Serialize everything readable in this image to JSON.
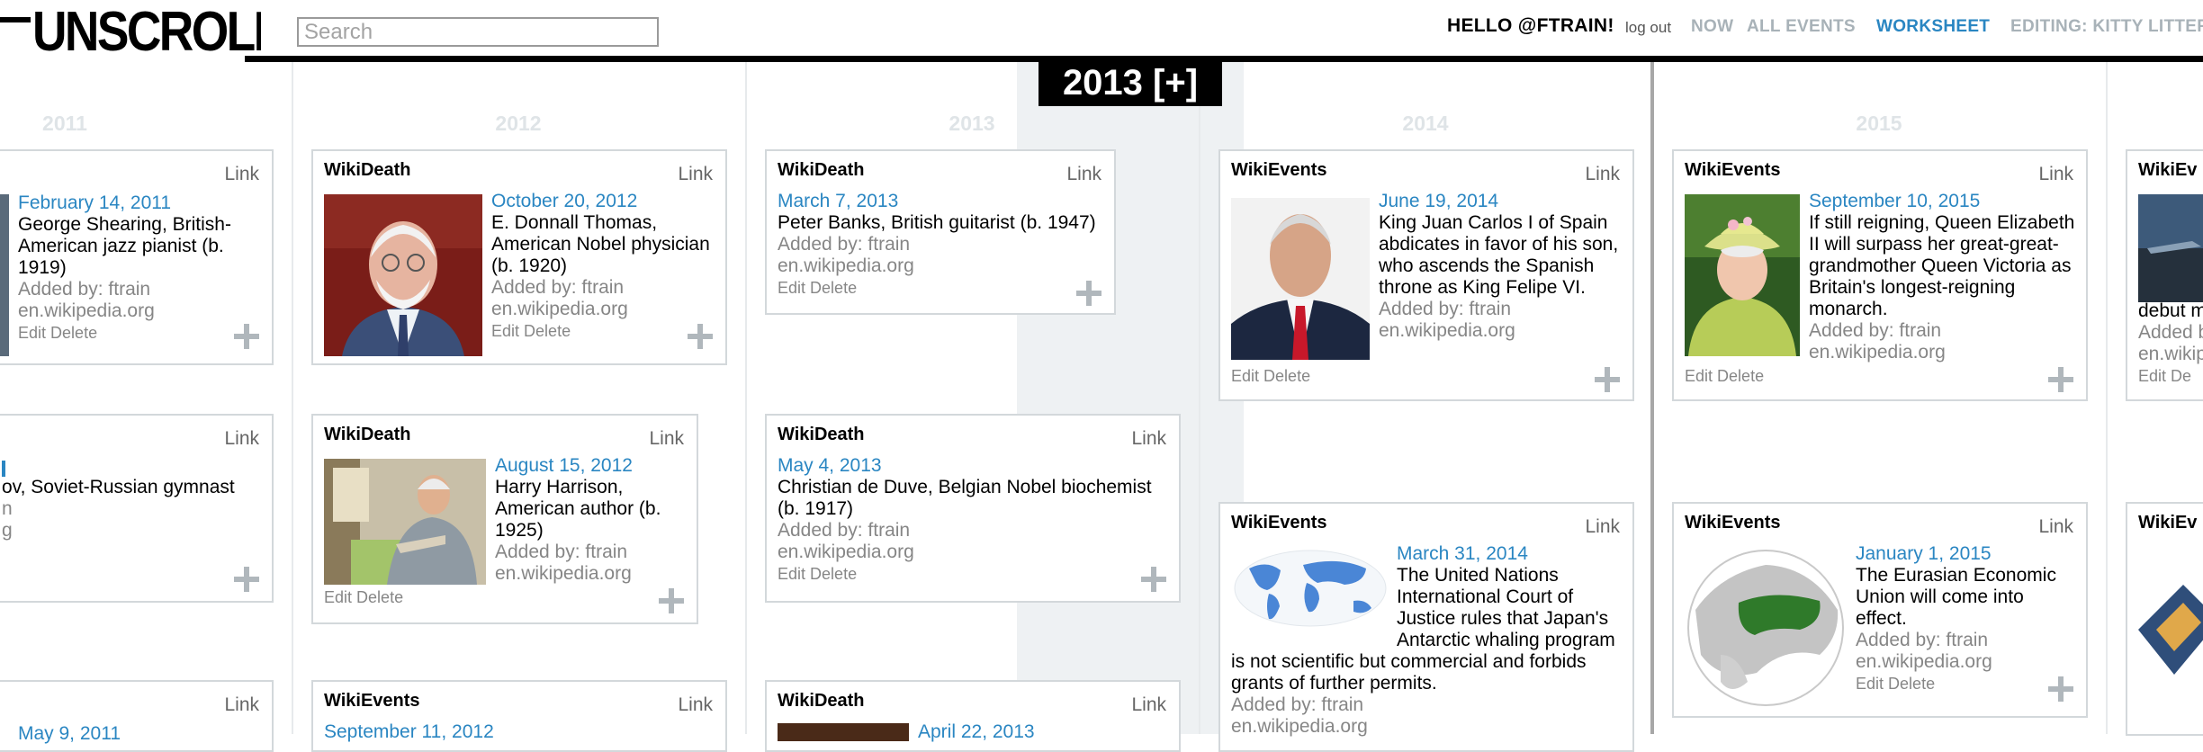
{
  "header": {
    "logo": "UNSCROLL",
    "search_placeholder": "Search",
    "greeting": "HELLO @FTRAIN!",
    "logout": "log out",
    "nav": {
      "now": "NOW",
      "all_events": "ALL EVENTS",
      "worksheet": "WORKSHEET",
      "editing": "EDITING: KITTY LITTER"
    }
  },
  "timeline": {
    "years": [
      "2011",
      "2012",
      "2013",
      "2014",
      "2015"
    ],
    "current_year_button": "2013 [+]"
  },
  "colors": {
    "accent": "#2a86c2",
    "muted_nav": "#a8b2b8",
    "card_border": "#d3d8db"
  },
  "card_common": {
    "link": "Link",
    "edit": "Edit",
    "delete": "Delete"
  },
  "cards": [
    {
      "source": "",
      "date": "February 14, 2011",
      "text": "George Shearing, British-American jazz pianist (b. 1919)",
      "added": "Added by: ftrain",
      "domain": "en.wikipedia.org"
    },
    {
      "source": "",
      "date": "",
      "text": "ov, Soviet-Russian gymnast",
      "added": "n",
      "domain": "g"
    },
    {
      "source": "",
      "date": "May 9, 2011"
    },
    {
      "source": "WikiDeath",
      "date": "October 20, 2012",
      "text": "E. Donnall Thomas, American Nobel physician (b. 1920)",
      "added": "Added by: ftrain",
      "domain": "en.wikipedia.org"
    },
    {
      "source": "WikiDeath",
      "date": "August 15, 2012",
      "text": "Harry Harrison, American author (b. 1925)",
      "added": "Added by: ftrain",
      "domain": "en.wikipedia.org"
    },
    {
      "source": "WikiEvents",
      "date": "September 11, 2012"
    },
    {
      "source": "WikiDeath",
      "date": "March 7, 2013",
      "text": "Peter Banks, British guitarist (b. 1947)",
      "added": "Added by: ftrain",
      "domain": "en.wikipedia.org"
    },
    {
      "source": "WikiDeath",
      "date": "May 4, 2013",
      "text": "Christian de Duve, Belgian Nobel biochemist (b. 1917)",
      "added": "Added by: ftrain",
      "domain": "en.wikipedia.org"
    },
    {
      "source": "WikiDeath",
      "date": "April 22, 2013"
    },
    {
      "source": "WikiEvents",
      "date": "June 19, 2014",
      "text": "King Juan Carlos I of Spain abdicates in favor of his son, who ascends the Spanish throne as King Felipe VI.",
      "added": "Added by: ftrain",
      "domain": "en.wikipedia.org"
    },
    {
      "source": "WikiEvents",
      "date": "March 31, 2014",
      "text": "The United Nations International Court of Justice rules that Japan's Antarctic whaling program is not scientific but commercial and forbids grants of further permits.",
      "added": "Added by: ftrain",
      "domain": "en.wikipedia.org"
    },
    {
      "source": "WikiEvents",
      "date": "September 10, 2015",
      "text": "If still reigning, Queen Elizabeth II will surpass her great-great-grandmother Queen Victoria as Britain's longest-reigning monarch.",
      "added": "Added by: ftrain",
      "domain": "en.wikipedia.org"
    },
    {
      "source": "WikiEvents",
      "date": "January 1, 2015",
      "text": "The Eurasian Economic Union will come into effect.",
      "added": "Added by: ftrain",
      "domain": "en.wikipedia.org"
    },
    {
      "source": "WikiEv",
      "date": "",
      "text": "debut m",
      "added": "Added b",
      "domain": "en.wikip",
      "edit": "Edit De"
    },
    {
      "source": "WikiEv"
    }
  ]
}
